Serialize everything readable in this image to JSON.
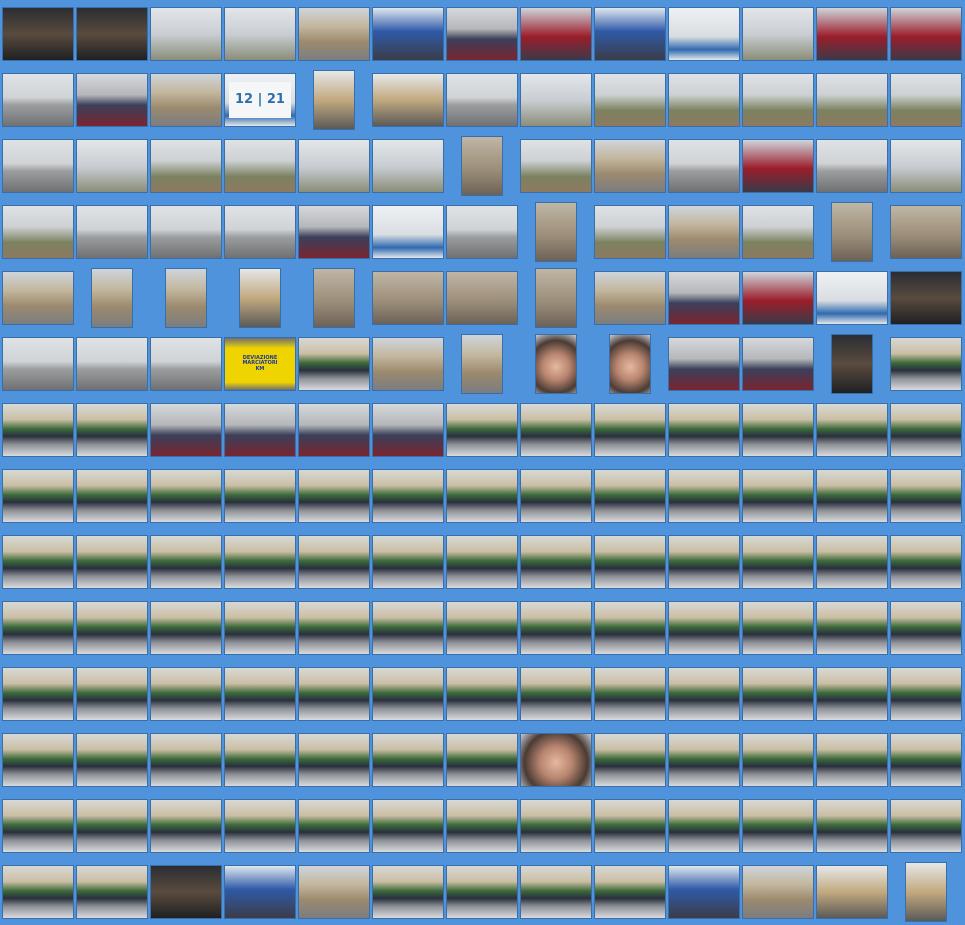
{
  "gallery": {
    "rows": [
      {
        "thumbs": [
          {
            "scene": "scene-night"
          },
          {
            "scene": "scene-night"
          },
          {
            "scene": "scene-fog"
          },
          {
            "scene": "scene-fog"
          },
          {
            "scene": "scene-town"
          },
          {
            "scene": "scene-blue"
          },
          {
            "scene": "scene-crowd"
          },
          {
            "scene": "scene-red"
          },
          {
            "scene": "scene-blue"
          },
          {
            "scene": "scene-snow"
          },
          {
            "scene": "scene-fog"
          },
          {
            "scene": "scene-red"
          },
          {
            "scene": "scene-red"
          }
        ]
      },
      {
        "thumbs": [
          {
            "scene": "scene-road"
          },
          {
            "scene": "scene-crowd"
          },
          {
            "scene": "scene-town"
          },
          {
            "scene": "scene-snow",
            "label": "12 | 21"
          },
          {
            "scene": "scene-church",
            "orientation": "portrait"
          },
          {
            "scene": "scene-church"
          },
          {
            "scene": "scene-road"
          },
          {
            "scene": "scene-fog"
          },
          {
            "scene": "scene-vineyard"
          },
          {
            "scene": "scene-vineyard"
          },
          {
            "scene": "scene-vineyard"
          },
          {
            "scene": "scene-vineyard"
          },
          {
            "scene": "scene-vineyard"
          }
        ]
      },
      {
        "thumbs": [
          {
            "scene": "scene-road"
          },
          {
            "scene": "scene-fog"
          },
          {
            "scene": "scene-vineyard"
          },
          {
            "scene": "scene-vineyard"
          },
          {
            "scene": "scene-fog"
          },
          {
            "scene": "scene-fog"
          },
          {
            "scene": "scene-arch",
            "orientation": "portrait"
          },
          {
            "scene": "scene-vineyard"
          },
          {
            "scene": "scene-town"
          },
          {
            "scene": "scene-road"
          },
          {
            "scene": "scene-red"
          },
          {
            "scene": "scene-road"
          },
          {
            "scene": "scene-fog"
          }
        ]
      },
      {
        "thumbs": [
          {
            "scene": "scene-vineyard"
          },
          {
            "scene": "scene-road"
          },
          {
            "scene": "scene-road"
          },
          {
            "scene": "scene-road"
          },
          {
            "scene": "scene-crowd"
          },
          {
            "scene": "scene-snow"
          },
          {
            "scene": "scene-road"
          },
          {
            "scene": "scene-arch",
            "orientation": "portrait"
          },
          {
            "scene": "scene-vineyard"
          },
          {
            "scene": "scene-town"
          },
          {
            "scene": "scene-vineyard"
          },
          {
            "scene": "scene-arch",
            "orientation": "portrait"
          },
          {
            "scene": "scene-arch"
          }
        ]
      },
      {
        "thumbs": [
          {
            "scene": "scene-town"
          },
          {
            "scene": "scene-town",
            "orientation": "portrait"
          },
          {
            "scene": "scene-town",
            "orientation": "portrait"
          },
          {
            "scene": "scene-church",
            "orientation": "portrait"
          },
          {
            "scene": "scene-arch",
            "orientation": "portrait"
          },
          {
            "scene": "scene-arch"
          },
          {
            "scene": "scene-arch"
          },
          {
            "scene": "scene-arch",
            "orientation": "portrait"
          },
          {
            "scene": "scene-town"
          },
          {
            "scene": "scene-crowd"
          },
          {
            "scene": "scene-red"
          },
          {
            "scene": "scene-snow"
          },
          {
            "scene": "scene-night"
          }
        ]
      },
      {
        "thumbs": [
          {
            "scene": "scene-road"
          },
          {
            "scene": "scene-road"
          },
          {
            "scene": "scene-road"
          },
          {
            "scene": "scene-sign",
            "label": "DEVIAZIONE\nMARCIATORI\nKM"
          },
          {
            "scene": "scene-finish"
          },
          {
            "scene": "scene-town"
          },
          {
            "scene": "scene-town",
            "orientation": "portrait"
          },
          {
            "scene": "scene-face",
            "orientation": "portrait"
          },
          {
            "scene": "scene-face",
            "orientation": "portrait"
          },
          {
            "scene": "scene-crowd"
          },
          {
            "scene": "scene-crowd"
          },
          {
            "scene": "scene-night",
            "orientation": "portrait"
          },
          {
            "scene": "scene-finish"
          }
        ]
      },
      {
        "thumbs": [
          {
            "scene": "scene-finish"
          },
          {
            "scene": "scene-finish"
          },
          {
            "scene": "scene-crowd"
          },
          {
            "scene": "scene-crowd"
          },
          {
            "scene": "scene-crowd"
          },
          {
            "scene": "scene-crowd"
          },
          {
            "scene": "scene-finish"
          },
          {
            "scene": "scene-finish"
          },
          {
            "scene": "scene-finish"
          },
          {
            "scene": "scene-finish"
          },
          {
            "scene": "scene-finish"
          },
          {
            "scene": "scene-finish"
          },
          {
            "scene": "scene-finish"
          }
        ]
      },
      {
        "thumbs": [
          {
            "scene": "scene-finish"
          },
          {
            "scene": "scene-finish"
          },
          {
            "scene": "scene-finish"
          },
          {
            "scene": "scene-finish"
          },
          {
            "scene": "scene-finish"
          },
          {
            "scene": "scene-finish"
          },
          {
            "scene": "scene-finish"
          },
          {
            "scene": "scene-finish"
          },
          {
            "scene": "scene-finish"
          },
          {
            "scene": "scene-finish"
          },
          {
            "scene": "scene-finish"
          },
          {
            "scene": "scene-finish"
          },
          {
            "scene": "scene-finish"
          }
        ]
      },
      {
        "thumbs": [
          {
            "scene": "scene-finish"
          },
          {
            "scene": "scene-finish"
          },
          {
            "scene": "scene-finish"
          },
          {
            "scene": "scene-finish"
          },
          {
            "scene": "scene-finish"
          },
          {
            "scene": "scene-finish"
          },
          {
            "scene": "scene-finish"
          },
          {
            "scene": "scene-finish"
          },
          {
            "scene": "scene-finish"
          },
          {
            "scene": "scene-finish"
          },
          {
            "scene": "scene-finish"
          },
          {
            "scene": "scene-finish"
          },
          {
            "scene": "scene-finish"
          }
        ]
      },
      {
        "thumbs": [
          {
            "scene": "scene-finish"
          },
          {
            "scene": "scene-finish"
          },
          {
            "scene": "scene-finish"
          },
          {
            "scene": "scene-finish"
          },
          {
            "scene": "scene-finish"
          },
          {
            "scene": "scene-finish"
          },
          {
            "scene": "scene-finish"
          },
          {
            "scene": "scene-finish"
          },
          {
            "scene": "scene-finish"
          },
          {
            "scene": "scene-finish"
          },
          {
            "scene": "scene-finish"
          },
          {
            "scene": "scene-finish"
          },
          {
            "scene": "scene-finish"
          }
        ]
      },
      {
        "thumbs": [
          {
            "scene": "scene-finish"
          },
          {
            "scene": "scene-finish"
          },
          {
            "scene": "scene-finish"
          },
          {
            "scene": "scene-finish"
          },
          {
            "scene": "scene-finish"
          },
          {
            "scene": "scene-finish"
          },
          {
            "scene": "scene-finish"
          },
          {
            "scene": "scene-finish"
          },
          {
            "scene": "scene-finish"
          },
          {
            "scene": "scene-finish"
          },
          {
            "scene": "scene-finish"
          },
          {
            "scene": "scene-finish"
          },
          {
            "scene": "scene-finish"
          }
        ]
      },
      {
        "thumbs": [
          {
            "scene": "scene-finish"
          },
          {
            "scene": "scene-finish"
          },
          {
            "scene": "scene-finish"
          },
          {
            "scene": "scene-finish"
          },
          {
            "scene": "scene-finish"
          },
          {
            "scene": "scene-finish"
          },
          {
            "scene": "scene-finish"
          },
          {
            "scene": "scene-face"
          },
          {
            "scene": "scene-finish"
          },
          {
            "scene": "scene-finish"
          },
          {
            "scene": "scene-finish"
          },
          {
            "scene": "scene-finish"
          },
          {
            "scene": "scene-finish"
          }
        ]
      },
      {
        "thumbs": [
          {
            "scene": "scene-finish"
          },
          {
            "scene": "scene-finish"
          },
          {
            "scene": "scene-finish"
          },
          {
            "scene": "scene-finish"
          },
          {
            "scene": "scene-finish"
          },
          {
            "scene": "scene-finish"
          },
          {
            "scene": "scene-finish"
          },
          {
            "scene": "scene-finish"
          },
          {
            "scene": "scene-finish"
          },
          {
            "scene": "scene-finish"
          },
          {
            "scene": "scene-finish"
          },
          {
            "scene": "scene-finish"
          },
          {
            "scene": "scene-finish"
          }
        ]
      },
      {
        "thumbs": [
          {
            "scene": "scene-finish"
          },
          {
            "scene": "scene-finish"
          },
          {
            "scene": "scene-night"
          },
          {
            "scene": "scene-blue"
          },
          {
            "scene": "scene-town"
          },
          {
            "scene": "scene-finish"
          },
          {
            "scene": "scene-finish"
          },
          {
            "scene": "scene-finish"
          },
          {
            "scene": "scene-finish"
          },
          {
            "scene": "scene-blue"
          },
          {
            "scene": "scene-town"
          },
          {
            "scene": "scene-church"
          },
          {
            "scene": "scene-church",
            "orientation": "portrait"
          }
        ]
      }
    ]
  }
}
